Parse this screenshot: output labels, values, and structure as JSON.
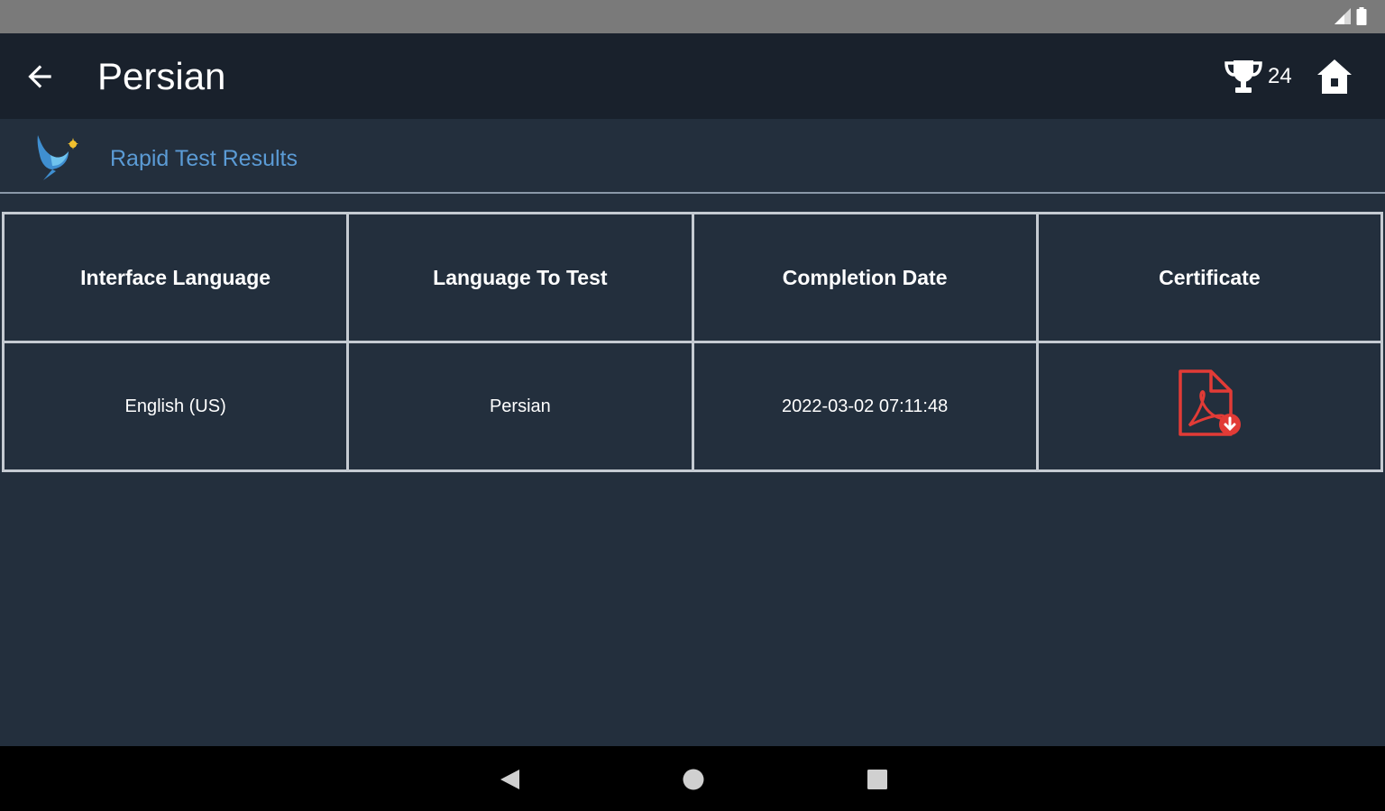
{
  "app_bar": {
    "title": "Persian",
    "trophy_count": "24"
  },
  "section": {
    "title": "Rapid Test Results"
  },
  "table": {
    "headers": [
      "Interface Language",
      "Language To Test",
      "Completion Date",
      "Certificate"
    ],
    "rows": [
      {
        "interface_language": "English (US)",
        "language_to_test": "Persian",
        "completion_date": "2022-03-02 07:11:48",
        "certificate_icon": "pdf-download-icon"
      }
    ]
  },
  "colors": {
    "app_bar_bg": "#19212c",
    "content_bg": "#232f3d",
    "section_title": "#5b9bd5",
    "pdf_red": "#e23b36"
  },
  "icons": {
    "back": "arrow-left-icon",
    "trophy": "trophy-icon",
    "home": "home-icon",
    "logo": "bird-logo-icon",
    "nav_back": "nav-back-icon",
    "nav_home": "nav-home-icon",
    "nav_recents": "nav-recents-icon"
  }
}
